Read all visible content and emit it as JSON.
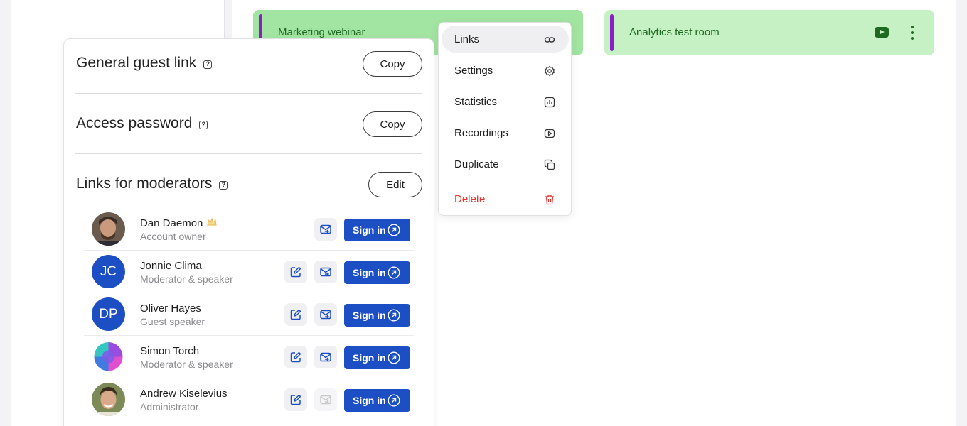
{
  "rooms": [
    {
      "name": "Marketing webinar"
    },
    {
      "name": "Analytics test room"
    }
  ],
  "links_panel": {
    "general_guest_link": {
      "title": "General guest link",
      "button": "Copy"
    },
    "access_password": {
      "title": "Access password",
      "button": "Copy"
    },
    "moderators": {
      "title": "Links for moderators",
      "button": "Edit"
    },
    "help_glyph": "?"
  },
  "moderators": [
    {
      "name": "Dan Daemon",
      "role": "Account owner",
      "avatar": "photo",
      "badge": "crown-icon"
    },
    {
      "name": "Jonnie Clima",
      "role": "Moderator & speaker",
      "avatar_initials": "JC"
    },
    {
      "name": "Oliver Hayes",
      "role": "Guest speaker",
      "avatar_initials": "DP"
    },
    {
      "name": "Simon Torch",
      "role": "Moderator & speaker",
      "avatar": "gradient-logo"
    },
    {
      "name": "Andrew Kiselevius",
      "role": "Administrator",
      "avatar": "photo"
    }
  ],
  "sign_in_label": "Sign in",
  "context_menu": {
    "items": [
      {
        "label": "Links",
        "icon": "link-icon",
        "active": true
      },
      {
        "label": "Settings",
        "icon": "gear-icon"
      },
      {
        "label": "Statistics",
        "icon": "statistics-icon"
      },
      {
        "label": "Recordings",
        "icon": "recordings-icon"
      },
      {
        "label": "Duplicate",
        "icon": "duplicate-icon"
      },
      {
        "label": "Delete",
        "icon": "trash-icon",
        "danger": true
      }
    ]
  },
  "colors": {
    "accent_blue": "#1d4fc4",
    "room_green": "#c5f1c5",
    "room_green_active": "#a2e4a2",
    "room_text": "#1e6a21",
    "room_bar_purple": "#8a1fc5",
    "danger_red": "#e8322b"
  }
}
